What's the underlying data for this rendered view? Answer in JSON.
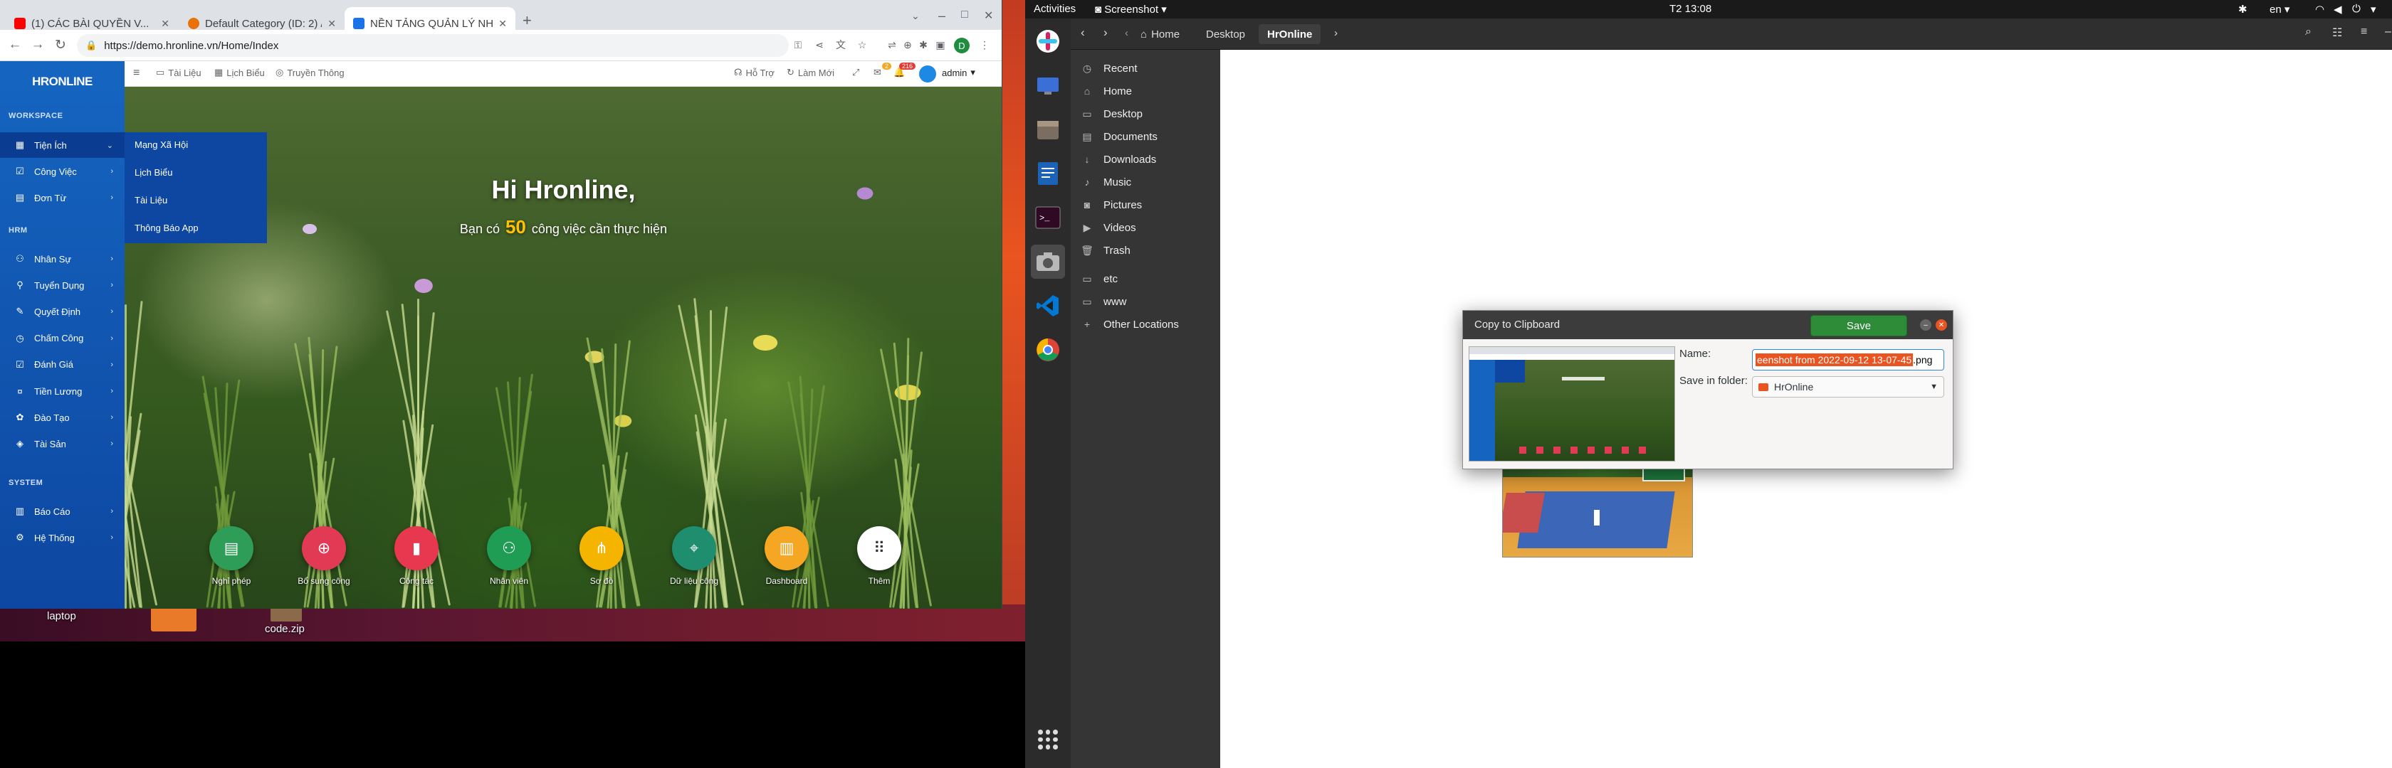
{
  "browser": {
    "tabs": [
      {
        "title": "(1) CÁC BÀI QUYỀN V...",
        "favicon_color": "#ff0000"
      },
      {
        "title": "Default Category (ID: 2) /...",
        "favicon_color": "#e8710a"
      },
      {
        "title": "NỀN TẢNG QUẢN LÝ NH...",
        "favicon_color": "#1a73e8"
      }
    ],
    "url": "https://demo.hronline.vn/Home/Index",
    "profile_initial": "D"
  },
  "app": {
    "logo": "HRONLINE",
    "topnav": [
      "Tài Liệu",
      "Lịch Biểu",
      "Truyền Thông"
    ],
    "top_right": {
      "support": "Hỗ Trợ",
      "invite": "Làm Mới",
      "badge_a": "2",
      "badge_b": "216",
      "user": "admin"
    },
    "sidebar": {
      "workspace_label": "WORKSPACE",
      "workspace_items": [
        {
          "label": "Tiện Ích",
          "icon": "grid-icon"
        },
        {
          "label": "Công Việc",
          "icon": "tasks-icon"
        },
        {
          "label": "Đơn Từ",
          "icon": "form-icon"
        }
      ],
      "hrm_label": "HRM",
      "hrm_items": [
        {
          "label": "Nhân Sự",
          "icon": "people-icon"
        },
        {
          "label": "Tuyển Dụng",
          "icon": "recruit-icon"
        },
        {
          "label": "Quyết Định",
          "icon": "decision-icon"
        },
        {
          "label": "Chấm Công",
          "icon": "clock-icon"
        },
        {
          "label": "Đánh Giá",
          "icon": "review-icon"
        },
        {
          "label": "Tiền Lương",
          "icon": "money-icon"
        },
        {
          "label": "Đào Tạo",
          "icon": "training-icon"
        },
        {
          "label": "Tài Sản",
          "icon": "asset-icon"
        }
      ],
      "system_label": "SYSTEM",
      "system_items": [
        {
          "label": "Báo Cáo",
          "icon": "report-icon"
        },
        {
          "label": "Hệ Thống",
          "icon": "settings-icon"
        }
      ]
    },
    "submenu": [
      "Mạng Xã Hội",
      "Lịch Biểu",
      "Tài Liệu",
      "Thông Báo App"
    ],
    "greeting": "Hi Hronline,",
    "task_prefix": "Bạn có",
    "task_count": "50",
    "task_suffix": "công việc cần thực hiện",
    "quick_apps": [
      {
        "label": "Nghỉ phép",
        "color": "#2e9d57"
      },
      {
        "label": "Bổ sung công",
        "color": "#e23a55"
      },
      {
        "label": "Công tác",
        "color": "#e8384f"
      },
      {
        "label": "Nhân viên",
        "color": "#1f9d55"
      },
      {
        "label": "Sơ đồ",
        "color": "#f4b400"
      },
      {
        "label": "Dữ liệu công",
        "color": "#1e8e6e"
      },
      {
        "label": "Dashboard",
        "color": "#f5a623"
      },
      {
        "label": "Thêm",
        "color": "#ffffff"
      }
    ]
  },
  "desktop": {
    "icons": [
      "laptop",
      "code.zip"
    ]
  },
  "topbar": {
    "activities": "Activities",
    "app": "Screenshot",
    "clock": "T2 13:08",
    "lang": "en"
  },
  "files": {
    "breadcrumb": [
      "Home",
      "Desktop",
      "HrOnline"
    ],
    "places": [
      {
        "label": "Recent",
        "icon": "clock-icon"
      },
      {
        "label": "Home",
        "icon": "home-icon"
      },
      {
        "label": "Desktop",
        "icon": "folder-icon"
      },
      {
        "label": "Documents",
        "icon": "document-icon"
      },
      {
        "label": "Downloads",
        "icon": "download-icon"
      },
      {
        "label": "Music",
        "icon": "music-icon"
      },
      {
        "label": "Pictures",
        "icon": "camera-icon"
      },
      {
        "label": "Videos",
        "icon": "video-icon"
      },
      {
        "label": "Trash",
        "icon": "trash-icon"
      }
    ],
    "bookmarks": [
      "etc",
      "www"
    ],
    "other": "Other Locations"
  },
  "dialog": {
    "title": "Copy to Clipboard",
    "save": "Save",
    "name_label": "Name:",
    "name_selected": "eenshot from 2022-09-12 13-07-45",
    "name_ext": ".png",
    "folder_label": "Save in folder:",
    "folder_value": "HrOnline"
  }
}
